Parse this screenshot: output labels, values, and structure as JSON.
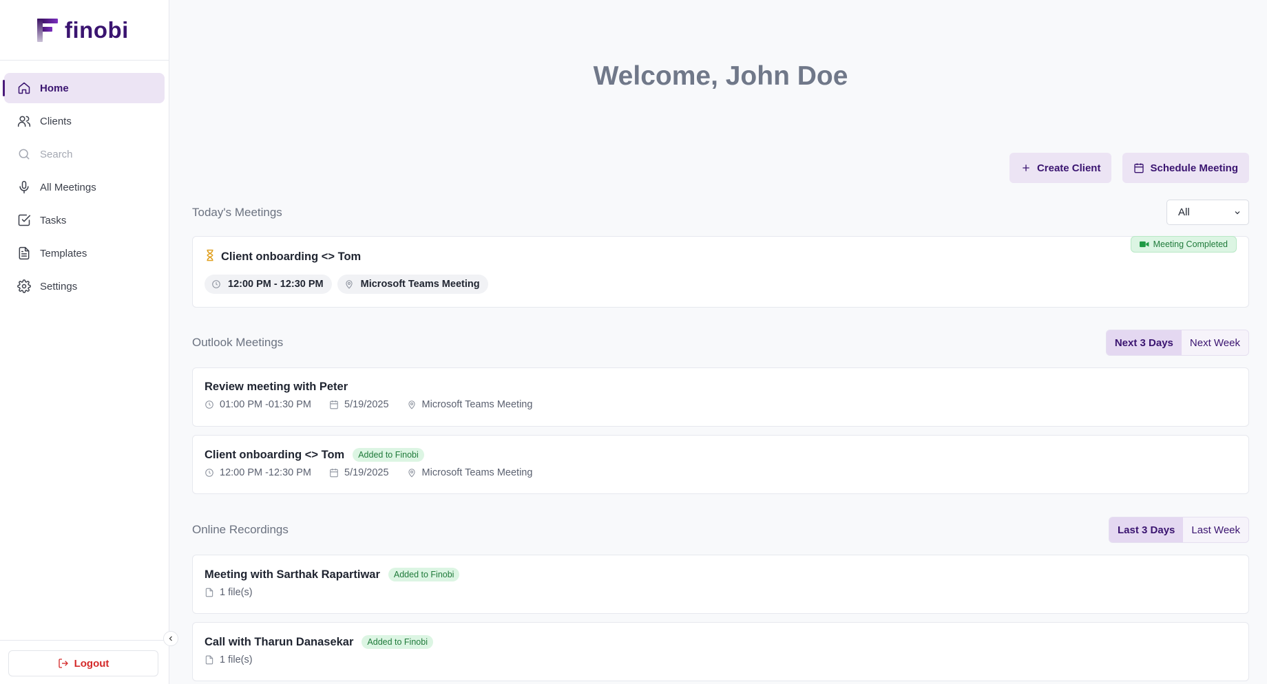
{
  "app": {
    "brand": "finobi",
    "accent": "#3a1470"
  },
  "sidebar": {
    "items": [
      {
        "label": "Home",
        "icon": "home-icon",
        "active": true
      },
      {
        "label": "Clients",
        "icon": "users-icon"
      },
      {
        "label": "Search",
        "icon": "search-icon",
        "disabled": true
      },
      {
        "label": "All Meetings",
        "icon": "mic-icon"
      },
      {
        "label": "Tasks",
        "icon": "check-square-icon"
      },
      {
        "label": "Templates",
        "icon": "file-icon"
      },
      {
        "label": "Settings",
        "icon": "gear-icon"
      }
    ],
    "logout_label": "Logout"
  },
  "main": {
    "welcome": "Welcome, John Doe",
    "actions": {
      "create_client": "Create Client",
      "schedule_meeting": "Schedule Meeting"
    },
    "today": {
      "title": "Today's Meetings",
      "filter": "All",
      "meeting": {
        "title": "Client onboarding <> Tom",
        "time": "12:00 PM - 12:30 PM",
        "location": "Microsoft Teams Meeting",
        "status": "Meeting Completed"
      }
    },
    "outlook": {
      "title": "Outlook Meetings",
      "tabs": [
        "Next 3 Days",
        "Next Week"
      ],
      "meetings": [
        {
          "title": "Review meeting with Peter",
          "time": "01:00 PM -01:30 PM",
          "date": "5/19/2025",
          "location": "Microsoft Teams Meeting",
          "badge": ""
        },
        {
          "title": "Client onboarding <> Tom",
          "time": "12:00 PM -12:30 PM",
          "date": "5/19/2025",
          "location": "Microsoft Teams Meeting",
          "badge": "Added to Finobi"
        }
      ]
    },
    "recordings": {
      "title": "Online Recordings",
      "tabs": [
        "Last 3 Days",
        "Last Week"
      ],
      "items": [
        {
          "title": "Meeting with Sarthak Rapartiwar",
          "badge": "Added to Finobi",
          "files": "1 file(s)"
        },
        {
          "title": "Call with Tharun Danasekar",
          "badge": "Added to Finobi",
          "files": "1 file(s)"
        }
      ]
    }
  }
}
